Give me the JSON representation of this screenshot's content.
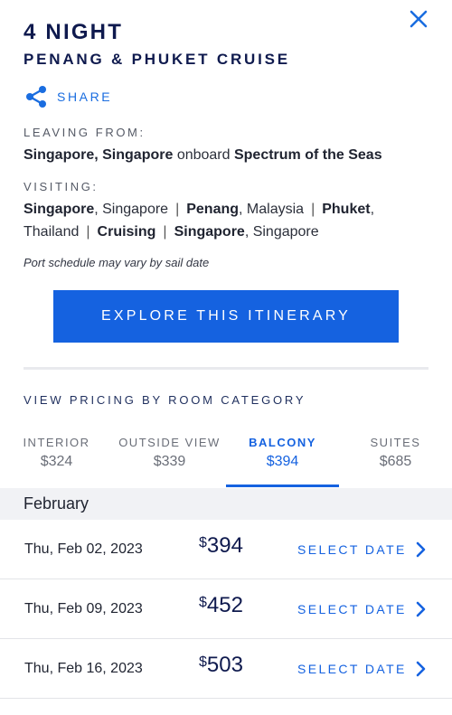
{
  "header": {
    "title": "4 NIGHT",
    "subtitle": "PENANG & PHUKET CRUISE",
    "close_icon": "close-icon"
  },
  "share": {
    "label": "SHARE",
    "icon": "share-icon"
  },
  "leaving": {
    "label": "LEAVING FROM:",
    "port": "Singapore, Singapore",
    "connector": "onboard",
    "ship": "Spectrum of the Seas"
  },
  "visiting": {
    "label": "VISITING:",
    "stops": [
      {
        "name": "Singapore",
        "region": "Singapore"
      },
      {
        "name": "Penang",
        "region": "Malaysia"
      },
      {
        "name": "Phuket",
        "region": "Thailand"
      },
      {
        "name": "Cruising",
        "region": ""
      },
      {
        "name": "Singapore",
        "region": "Singapore"
      }
    ],
    "separator": "|"
  },
  "note": "Port schedule may vary by sail date",
  "explore_button": "EXPLORE THIS ITINERARY",
  "pricing": {
    "heading": "VIEW PRICING BY ROOM CATEGORY",
    "tabs": [
      {
        "name": "INTERIOR",
        "price": "$324",
        "active": false
      },
      {
        "name": "OUTSIDE VIEW",
        "price": "$339",
        "active": false
      },
      {
        "name": "BALCONY",
        "price": "$394",
        "active": true
      },
      {
        "name": "SUITES",
        "price": "$685",
        "active": false
      }
    ]
  },
  "month": "February",
  "dates": [
    {
      "date": "Thu, Feb 02, 2023",
      "currency": "$",
      "price": "394",
      "action": "SELECT DATE"
    },
    {
      "date": "Thu, Feb 09, 2023",
      "currency": "$",
      "price": "452",
      "action": "SELECT DATE"
    },
    {
      "date": "Thu, Feb 16, 2023",
      "currency": "$",
      "price": "503",
      "action": "SELECT DATE"
    }
  ],
  "colors": {
    "accent": "#1562e0",
    "navy": "#0f1a4e",
    "close": "#1a6de0"
  }
}
